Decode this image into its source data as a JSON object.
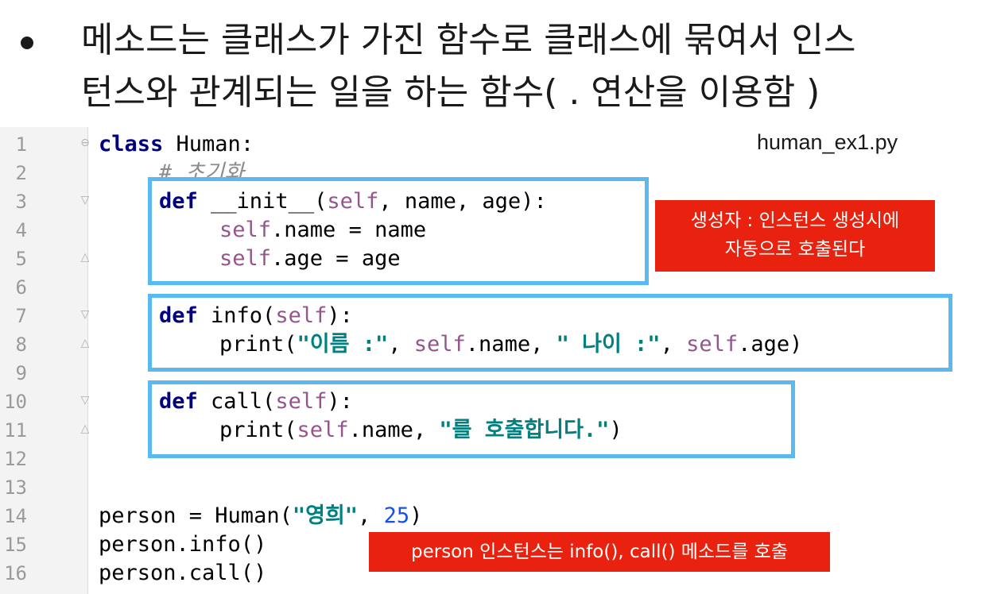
{
  "slide": {
    "bullet_line_1": "메소드는 클래스가 가진 함수로 클래스에 묶여서 인스",
    "bullet_line_2": "턴스와 관계되는 일을 하는 함수( . 연산을 이용함 )"
  },
  "editor": {
    "filename": "human_ex1.py",
    "line_numbers": [
      "1",
      "2",
      "3",
      "4",
      "5",
      "6",
      "7",
      "8",
      "9",
      "10",
      "11",
      "12",
      "13",
      "14",
      "15",
      "16"
    ],
    "code": {
      "l1_kw": "class",
      "l1_rest": " Human:",
      "l2_comment": "# 초기화",
      "l3_kw": "def",
      "l3_name": " __init__(",
      "l3_self": "self",
      "l3_rest": ", name, age):",
      "l4_self": "self",
      "l4_rest": ".name = name",
      "l5_self": "self",
      "l5_rest": ".age = age",
      "l7_kw": "def",
      "l7_name": " info(",
      "l7_self": "self",
      "l7_rest": "):",
      "l8_print": "print(",
      "l8_str1": "\"이름 :\"",
      "l8_sep1": ", ",
      "l8_self1": "self",
      "l8_mid": ".name, ",
      "l8_str2": "\" 나이 :\"",
      "l8_sep2": ", ",
      "l8_self2": "self",
      "l8_end": ".age)",
      "l10_kw": "def",
      "l10_name": " call(",
      "l10_self": "self",
      "l10_rest": "):",
      "l11_print": "print(",
      "l11_self": "self",
      "l11_mid": ".name, ",
      "l11_str": "\"를 호출합니다.\"",
      "l11_end": ")",
      "l14_a": "person = Human(",
      "l14_str": "\"영희\"",
      "l14_sep": ", ",
      "l14_num": "25",
      "l14_end": ")",
      "l15": "person.info()",
      "l16": "person.call()"
    }
  },
  "annotations": {
    "constructor_note_line1": "생성자 : 인스턴스 생성시에",
    "constructor_note_line2": "자동으로 호출된다",
    "call_note": "person 인스턴스는 info(), call() 메소드를 호출"
  },
  "colors": {
    "highlight_box": "#5ab9ef",
    "note_background": "#e8220e",
    "keyword": "#000080",
    "self": "#94558d",
    "string": "#008080",
    "number": "#1750eb"
  }
}
